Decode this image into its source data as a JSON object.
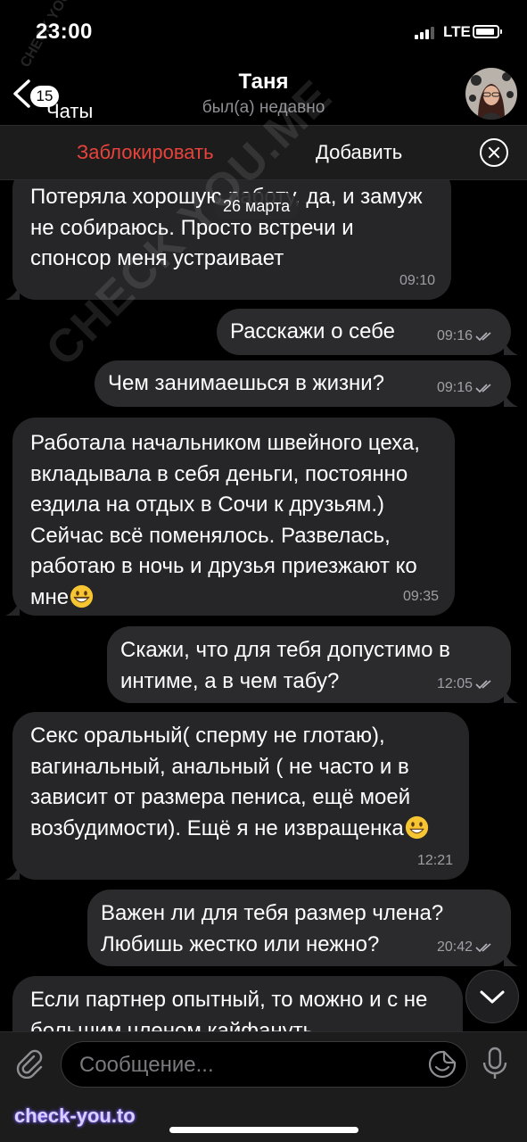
{
  "status_bar": {
    "time": "23:00",
    "network": "LTE"
  },
  "header": {
    "back_label": "Чаты",
    "unread_badge": "15",
    "title": "Таня",
    "subtitle": "был(а) недавно",
    "avatar_icon": "profile-photo"
  },
  "action_bar": {
    "block_label": "Заблокировать",
    "add_label": "Добавить",
    "close_icon": "close-circle-icon"
  },
  "chat": {
    "date_label": "26 марта",
    "messages": [
      {
        "dir": "in",
        "text": "Потеряла хорошую работу, да, и замуж не собираюсь. Просто встречи и спонсор меня устраивает",
        "time": "09:10"
      },
      {
        "dir": "out",
        "text": "Расскажи о себе",
        "time": "09:16"
      },
      {
        "dir": "out",
        "text": "Чем занимаешься в жизни?",
        "time": "09:16"
      },
      {
        "dir": "in",
        "text": "Работала начальником швейного цеха, вкладывала в себя деньги, постоянно ездила на отдых в Сочи к друзьям.) Сейчас всё поменялось. Развелась, работаю в ночь и друзья приезжают ко мне",
        "emoji": "grinning-face",
        "time": "09:35"
      },
      {
        "dir": "out",
        "text": "Скажи, что для тебя допустимо в интиме, а в чем табу?",
        "time": "12:05"
      },
      {
        "dir": "in",
        "text": "Секс оральный( сперму не глотаю), вагинальный, анальный ( не часто и в зависит от размера пениса, ещё моей возбудимости). Ещё я не извращенка",
        "emoji": "smiling-face",
        "time": "12:21"
      },
      {
        "dir": "out",
        "text": "Важен ли для тебя размер члена? Любишь жестко или нежно?",
        "time": "20:42"
      },
      {
        "dir": "in",
        "text": "Если партнер опытный, то можно и с не большим членом кайфануть"
      }
    ]
  },
  "input_bar": {
    "placeholder": "Сообщение..."
  },
  "watermarks": {
    "main": "CHECK YOU.ME",
    "corner": "CHECK YOU.ME",
    "bottom": "check-you.to"
  },
  "colors": {
    "danger": "#e7433a",
    "bubble_in": "#262628",
    "bubble_out": "#2b2b2d",
    "background": "#000000"
  }
}
